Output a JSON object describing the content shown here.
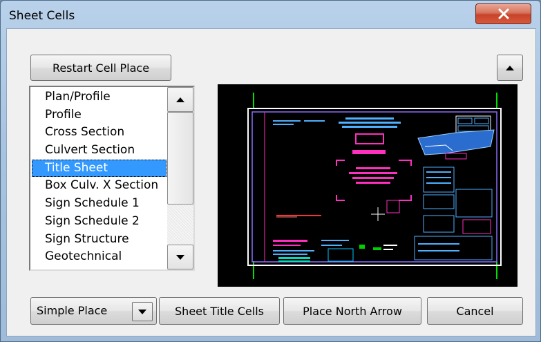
{
  "window": {
    "title": "Sheet Cells",
    "close_icon": "close-x-icon"
  },
  "toolbar": {
    "restart_label": "Restart Cell Place",
    "collapse_icon": "triangle-up-icon"
  },
  "cell_list": {
    "items": [
      "Plan/Profile",
      "Profile",
      "Cross Section",
      "Culvert Section",
      "Title Sheet",
      "Box Culv. X Section",
      "Sign Schedule 1",
      "Sign Schedule 2",
      "Sign Structure",
      "Geotechnical"
    ],
    "selected": "Title Sheet"
  },
  "bottom": {
    "place_mode": "Simple Place",
    "sheet_title_label": "Sheet Title Cells",
    "north_arrow_label": "Place North Arrow",
    "cancel_label": "Cancel"
  },
  "colors": {
    "selection": "#3399ff",
    "preview_bg": "#000000",
    "close_button": "#c7432a"
  }
}
